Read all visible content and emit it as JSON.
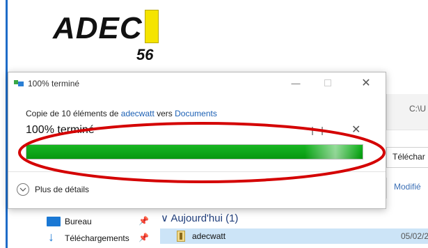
{
  "logo": {
    "text": "ADEC",
    "number": "56",
    "bar_color": "#f5e400"
  },
  "explorer": {
    "path_text": "C:\\U",
    "tab_text": "Téléchar",
    "column_text": "Modifié",
    "nav_items": [
      {
        "label": "Bureau",
        "icon": "desktop-icon"
      },
      {
        "label": "Téléchargements",
        "icon": "download-icon"
      }
    ],
    "group_header": "Aujourd'hui (1)",
    "file": {
      "name": "adecwatt",
      "date": "05/02/2"
    }
  },
  "dialog": {
    "title": "100% terminé",
    "copy_prefix": "Copie de 10 éléments de ",
    "source": "adecwatt",
    "copy_middle": " vers ",
    "destination": "Documents",
    "status": "100% terminé",
    "progress_percent": 100,
    "details_label": "Plus de détails",
    "accent_color": "#1a5fb4",
    "progress_color": "#0fa71a"
  },
  "annotation": {
    "color": "#d40000",
    "shape": "ellipse"
  }
}
